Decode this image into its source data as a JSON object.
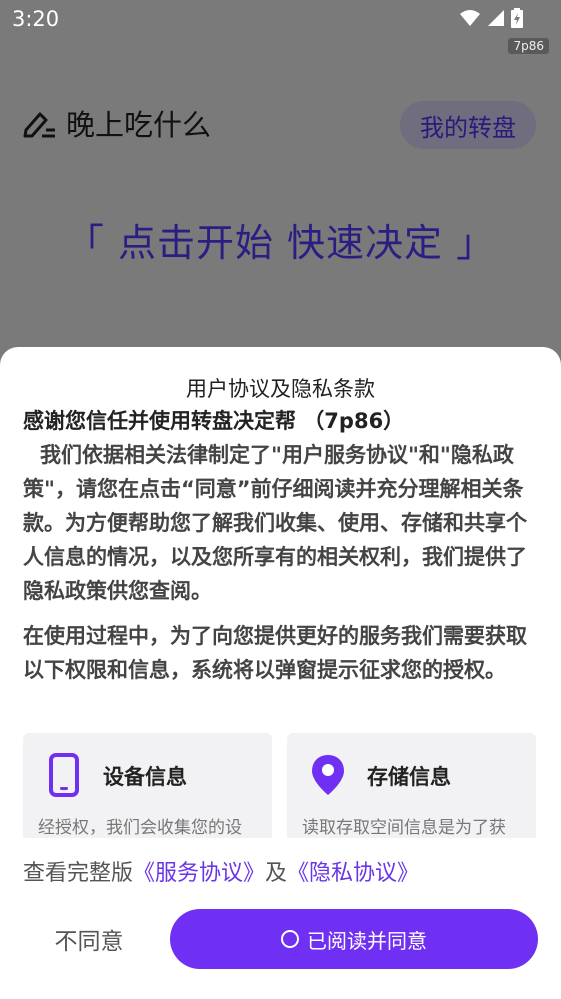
{
  "status_bar": {
    "time": "3:20",
    "badge": "7p86"
  },
  "header": {
    "app_title": "晚上吃什么",
    "my_wheel_button": "我的转盘"
  },
  "main": {
    "tagline": "「 点击开始 快速决定 」"
  },
  "dialog": {
    "title": "用户协议及隐私条款",
    "subtitle": "感谢您信任并使用转盘决定帮 （7p86）",
    "paragraph1": "我们依据相关法律制定了\"用户服务协议\"和\"隐私政策\"，请您在点击“同意”前仔细阅读并充分理解相关条款。为方便帮助您了解我们收集、使用、存储和共享个人信息的情况，以及您所享有的相关权利，我们提供了隐私政策供您查阅。",
    "paragraph2": "在使用过程中，为了向您提供更好的服务我们需要获取以下权限和信息，系统将以弹窗提示征求您的授权。",
    "permissions": [
      {
        "title": "设备信息",
        "description": "经授权，我们会收集您的设",
        "icon": "phone-icon"
      },
      {
        "title": "存储信息",
        "description": "读取存取空间信息是为了获",
        "icon": "location-pin-icon"
      }
    ],
    "links": {
      "prefix": "查看完整版",
      "service_agreement": "《服务协议》",
      "conjunction": "及",
      "privacy_agreement": "《隐私协议》"
    },
    "disagree_button": "不同意",
    "agree_button": "已阅读并同意"
  },
  "colors": {
    "accent": "#7030F3",
    "link": "#6A35E8",
    "tagline": "#2B1E82"
  }
}
